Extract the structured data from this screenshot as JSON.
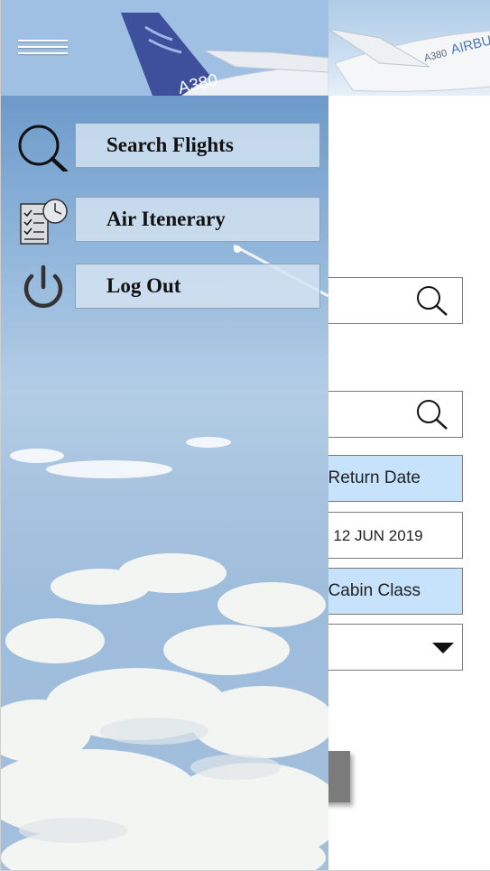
{
  "header": {
    "aircraft_model": "A380",
    "airline_text": "AIRBU"
  },
  "form": {
    "return_date_label": "Return Date",
    "return_date_value": ") 12 JUN 2019",
    "cabin_class_label": "Cabin Class"
  },
  "drawer": {
    "menu_items": [
      {
        "label": "Search Flights",
        "icon": "search-icon"
      },
      {
        "label": "Air Itenerary",
        "icon": "itinerary-clock-icon"
      },
      {
        "label": "Log Out",
        "icon": "power-icon"
      }
    ]
  },
  "colors": {
    "label_box_bg": "#c7e3fb",
    "drawer_sky": "#94b8dc",
    "search_button": "#7b7b7b"
  }
}
